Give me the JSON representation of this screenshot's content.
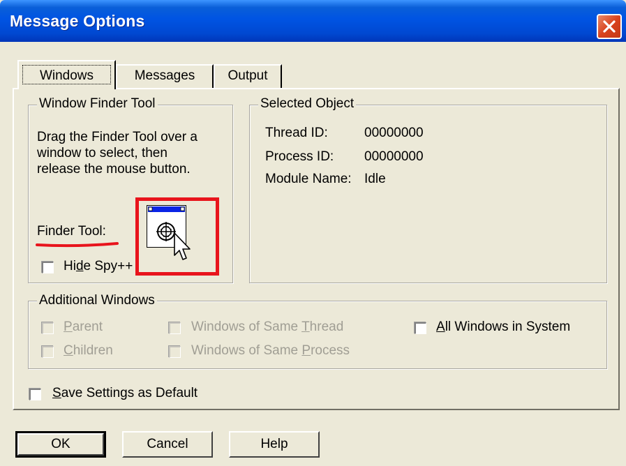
{
  "window": {
    "title": "Message Options"
  },
  "tabs": [
    {
      "label": "Windows",
      "selected": true
    },
    {
      "label": "Messages"
    },
    {
      "label": "Output"
    }
  ],
  "finder_group": {
    "title": "Window Finder Tool",
    "description_lines": [
      "Drag the Finder Tool over a",
      "window to select, then",
      "release the mouse button."
    ],
    "finder_label": "Finder Tool:",
    "hide_spy_label": "Hide Spy++",
    "hide_spy_checked": false
  },
  "selected_object": {
    "title": "Selected Object",
    "rows": [
      {
        "label": "Thread ID:",
        "value": "00000000"
      },
      {
        "label": "Process ID:",
        "value": "00000000"
      },
      {
        "label": "Module Name:",
        "value": "Idle"
      }
    ]
  },
  "additional_windows": {
    "title": "Additional Windows",
    "options": [
      {
        "label": "Parent",
        "enabled": false,
        "checked": false
      },
      {
        "label": "Children",
        "enabled": false,
        "checked": false
      },
      {
        "label": "Windows of Same Thread",
        "enabled": false,
        "checked": false
      },
      {
        "label": "Windows of Same Process",
        "enabled": false,
        "checked": false
      },
      {
        "label": "All Windows in System",
        "enabled": true,
        "checked": false
      }
    ]
  },
  "save_settings": {
    "label": "Save Settings as Default",
    "checked": false
  },
  "buttons": {
    "ok": "OK",
    "cancel": "Cancel",
    "help": "Help"
  },
  "annotation_color": "#E8141C"
}
